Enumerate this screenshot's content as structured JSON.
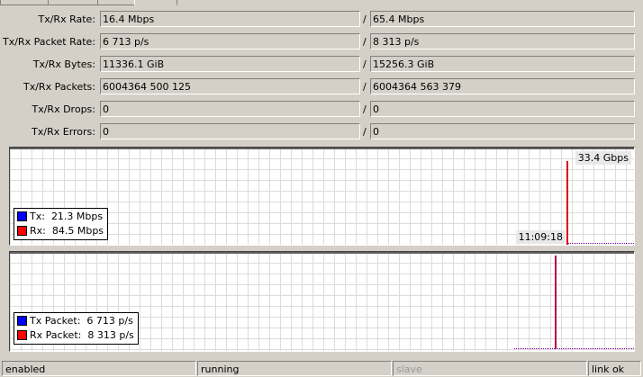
{
  "stats": [
    {
      "label": "Tx/Rx Rate:",
      "tx": "16.4 Mbps",
      "rx": "65.4 Mbps"
    },
    {
      "label": "Tx/Rx Packet Rate:",
      "tx": "6 713 p/s",
      "rx": "8 313 p/s"
    },
    {
      "label": "Tx/Rx Bytes:",
      "tx": "11336.1 GiB",
      "rx": "15256.3 GiB"
    },
    {
      "label": "Tx/Rx Packets:",
      "tx": "6004364 500 125",
      "rx": "6004364 563 379"
    },
    {
      "label": "Tx/Rx Drops:",
      "tx": "0",
      "rx": "0"
    },
    {
      "label": "Tx/Rx Errors:",
      "tx": "0",
      "rx": "0"
    }
  ],
  "separator": "/",
  "traffic_graph": {
    "max_label": "33.4 Gbps",
    "time_label": "11:09:18",
    "legend": [
      {
        "label": "Tx:",
        "value": "21.3 Mbps",
        "color": "#0000ff"
      },
      {
        "label": "Rx:",
        "value": "84.5 Mbps",
        "color": "#ff0000"
      }
    ]
  },
  "packet_graph": {
    "legend": [
      {
        "label": "Tx Packet:",
        "value": "6 713 p/s",
        "color": "#0000ff"
      },
      {
        "label": "Rx Packet:",
        "value": "8 313 p/s",
        "color": "#ff0000"
      }
    ]
  },
  "status_bar": {
    "state": "enabled",
    "run": "running",
    "slave": "slave",
    "link": "link ok"
  }
}
